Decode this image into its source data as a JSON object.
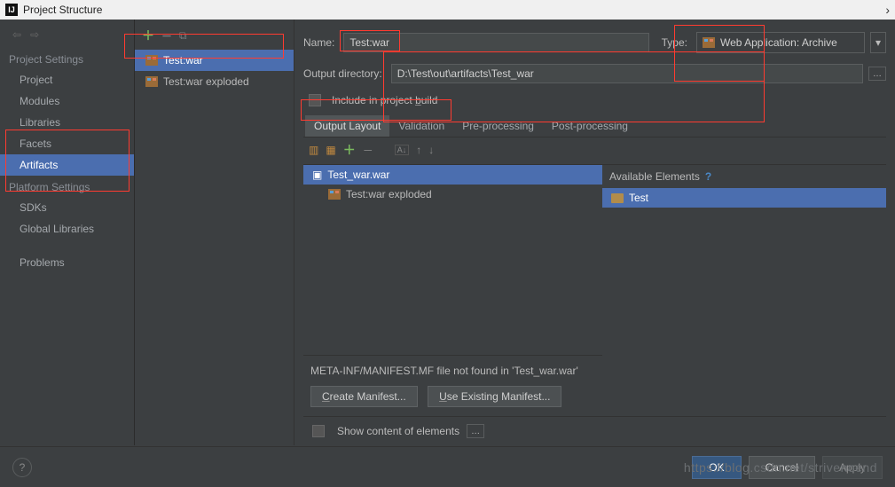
{
  "window": {
    "title": "Project Structure"
  },
  "sidebar": {
    "groups": [
      {
        "title": "Project Settings",
        "items": [
          "Project",
          "Modules",
          "Libraries",
          "Facets",
          "Artifacts"
        ]
      },
      {
        "title": "Platform Settings",
        "items": [
          "SDKs",
          "Global Libraries"
        ]
      },
      {
        "title": "",
        "items": [
          "Problems"
        ]
      }
    ],
    "selected": "Artifacts"
  },
  "artifact_list": {
    "items": [
      "Test:war",
      "Test:war exploded"
    ],
    "selected": "Test:war"
  },
  "form": {
    "name_label": "Name:",
    "name_value": "Test:war",
    "type_label": "Type:",
    "type_value": "Web Application: Archive",
    "outdir_label": "Output directory:",
    "outdir_value": "D:\\Test\\out\\artifacts\\Test_war",
    "include_label": "Include in project build"
  },
  "tabs": {
    "items": [
      "Output Layout",
      "Validation",
      "Pre-processing",
      "Post-processing"
    ],
    "selected": "Output Layout"
  },
  "output_layout": {
    "tree": [
      {
        "label": "Test_war.war",
        "selected": true
      },
      {
        "label": "Test:war exploded",
        "sub": true
      }
    ],
    "available_label": "Available Elements",
    "available_items": [
      "Test"
    ],
    "manifest_msg": "META-INF/MANIFEST.MF file not found in 'Test_war.war'",
    "create_btn": "Create Manifest...",
    "use_btn": "Use Existing Manifest...",
    "show_content_label": "Show content of elements"
  },
  "footer": {
    "ok": "OK",
    "cancel": "Cancel",
    "apply": "Apply"
  },
  "watermark": "https://blog.csdn.net/strivenoend"
}
